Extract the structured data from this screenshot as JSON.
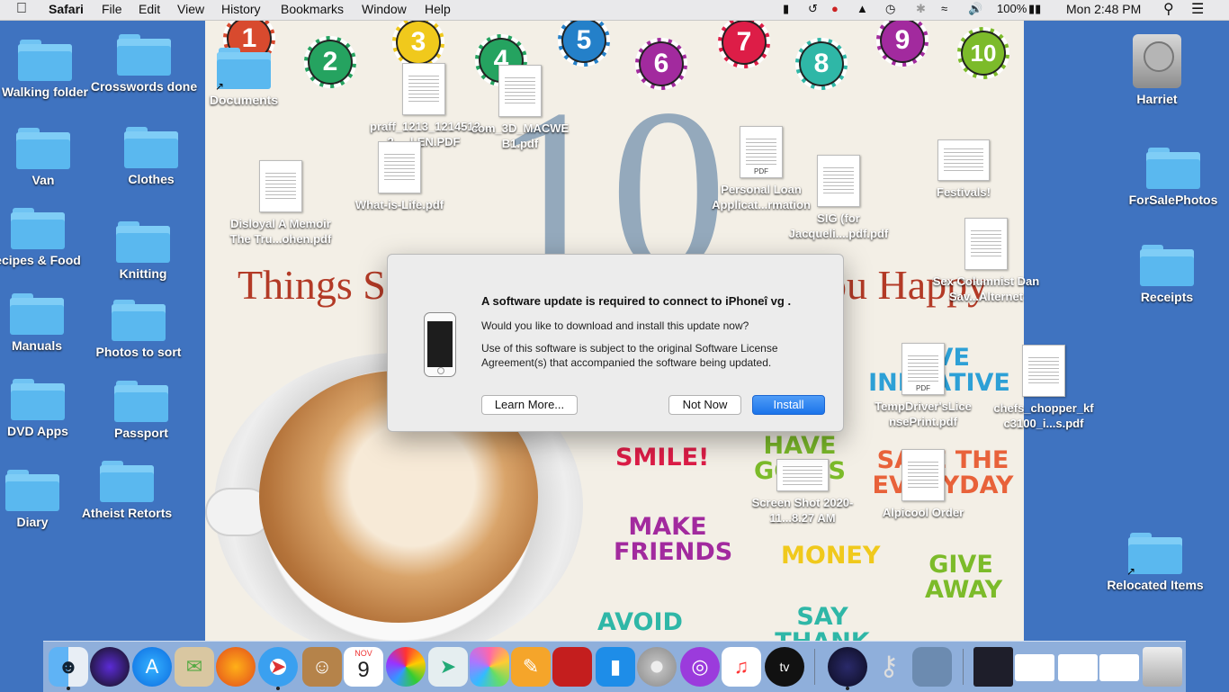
{
  "menubar": {
    "apple": "",
    "app_name": "Safari",
    "menus": [
      "File",
      "Edit",
      "View",
      "History",
      "Bookmarks",
      "Window",
      "Help"
    ],
    "battery": "100%",
    "clock": "Mon 2:48 PM"
  },
  "wallpaper": {
    "numbers": [
      "1",
      "2",
      "3",
      "4",
      "5",
      "6",
      "7",
      "8",
      "9",
      "10"
    ],
    "big_number": "10",
    "things_left": "Things S",
    "things_right": "ou Happy",
    "initiative": "TIVE INITIATIVE",
    "smile": "SMILE!",
    "have_goals": "HAVE GOALS",
    "make_friends": "MAKE FRIENDS",
    "save_money": "SAVE THE EVERYDAY",
    "money": "MONEY",
    "give_away": "GIVE AWAY",
    "avoid": "AVOID",
    "say_thank": "SAY THANK YOU"
  },
  "desktop": {
    "left": [
      {
        "label": "Walking folder"
      },
      {
        "label": "Crosswords done"
      },
      {
        "label": "Van"
      },
      {
        "label": "Clothes"
      },
      {
        "label": "ecipes & Food"
      },
      {
        "label": "Knitting"
      },
      {
        "label": "Manuals"
      },
      {
        "label": "Photos to sort"
      },
      {
        "label": "DVD Apps"
      },
      {
        "label": "Passport"
      },
      {
        "label": "Diary"
      },
      {
        "label": "Atheist Retorts"
      }
    ],
    "middle": [
      {
        "label": "Documents"
      },
      {
        "label": "praff_1213_1214512... 2.....l-EN.PDF"
      },
      {
        "label": "com_3D_MACWE B1.pdf"
      },
      {
        "label": "What-is-Life.pdf"
      },
      {
        "label": "Disloyal A Memoir The Tru...ohen.pdf"
      },
      {
        "label": "Personal Loan Applicat...rmation"
      },
      {
        "label": "SIG (for Jacqueli....pdf.pdf"
      },
      {
        "label": "Festivals!"
      },
      {
        "label": "Sex Columnist Dan Sav...Alternet"
      },
      {
        "label": "TempDriver'sLice nsePrint.pdf"
      },
      {
        "label": "chefs_chopper_kf c3100_i...s.pdf"
      },
      {
        "label": "Screen Shot 2020-11...8.27 AM"
      },
      {
        "label": "Alpicool Order"
      }
    ],
    "right": [
      {
        "label": "Harriet"
      },
      {
        "label": "ForSalePhotos"
      },
      {
        "label": "Receipts"
      },
      {
        "label": "Relocated Items"
      }
    ],
    "doc_tag": "PDF"
  },
  "dialog": {
    "title": "A software update is required to connect to iPhoneî vg .",
    "question": "Would you like to download and install this update now?",
    "license": "Use of this software is subject to the original Software License Agreement(s) that accompanied the software being updated.",
    "learn_more": "Learn More...",
    "not_now": "Not Now",
    "install": "Install"
  },
  "dock": {
    "calendar_month": "NOV",
    "calendar_day": "9",
    "tv_label": "tv"
  },
  "colors": {
    "desktop": "#3f73c0",
    "accent": "#1b74ea"
  }
}
